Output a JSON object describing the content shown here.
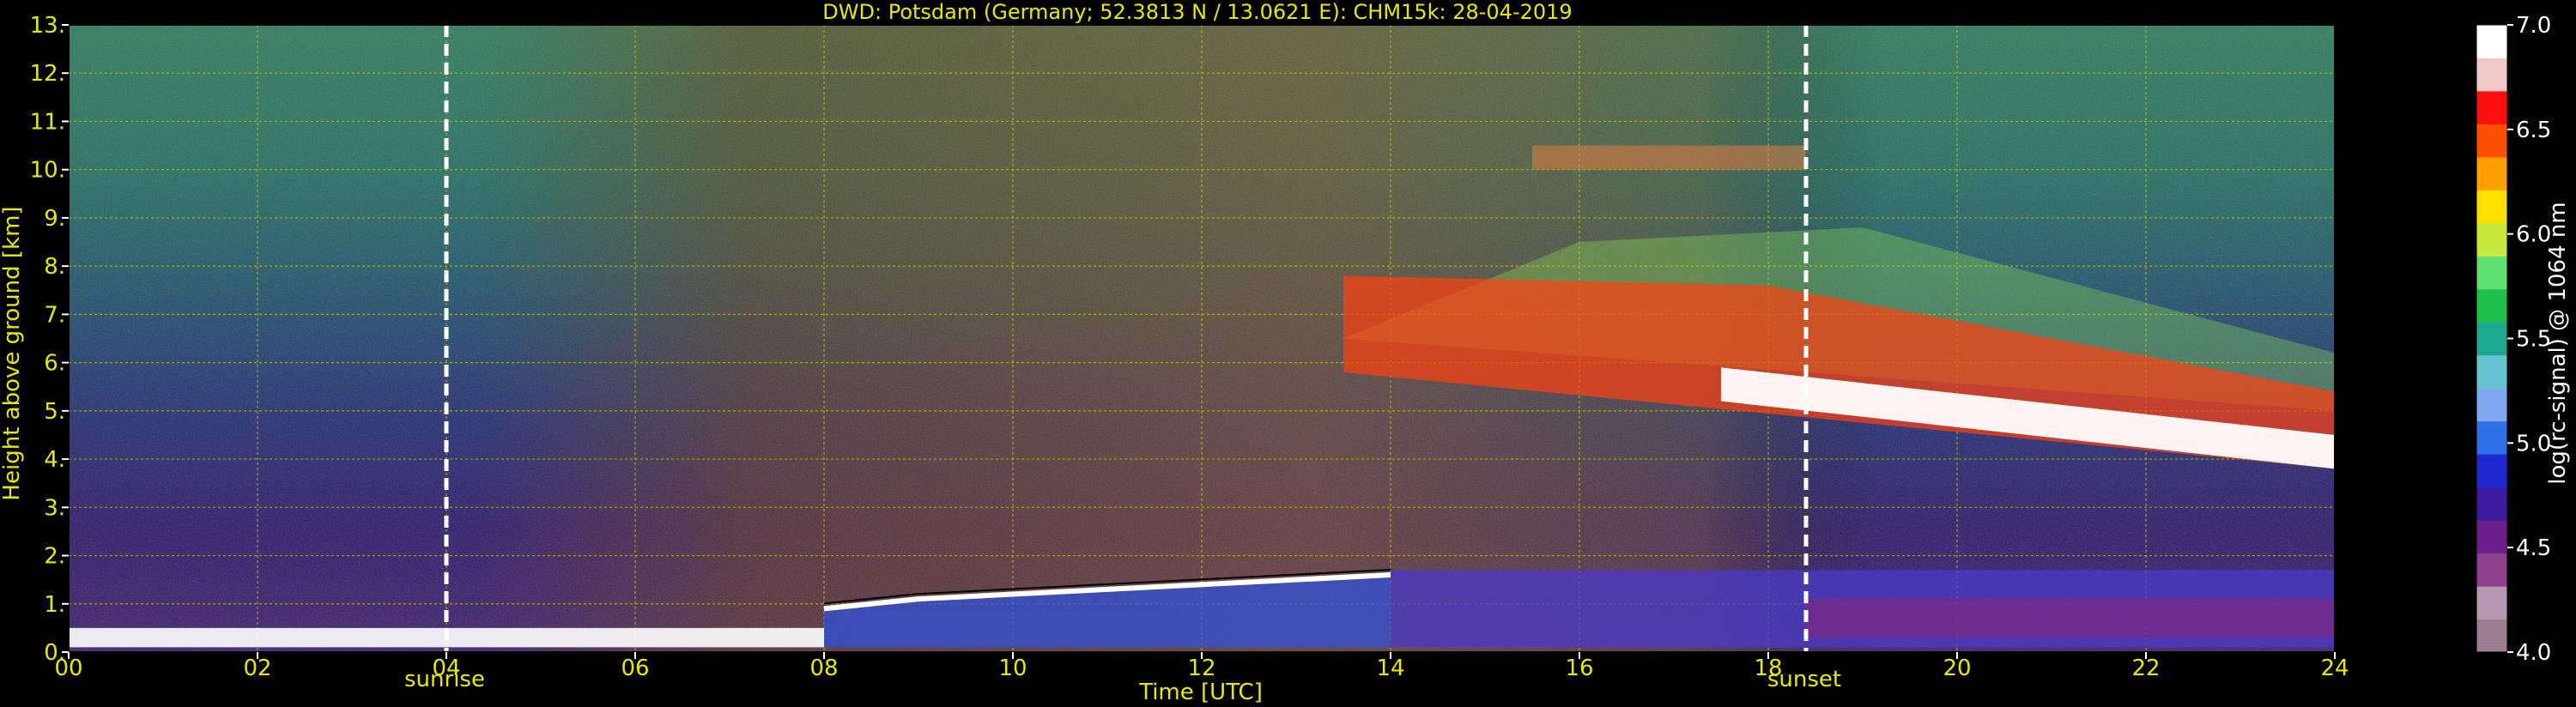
{
  "chart_data": {
    "type": "heatmap",
    "title": "DWD: Potsdam (Germany; 52.3813 N / 13.0621 E):    CHM15k: 28-04-2019",
    "xlabel": "Time [UTC]",
    "ylabel": "Height above ground [km]",
    "xlim": [
      0,
      24
    ],
    "ylim": [
      0,
      13
    ],
    "x_ticks": [
      "00",
      "02",
      "04",
      "06",
      "08",
      "10",
      "12",
      "14",
      "16",
      "18",
      "20",
      "22",
      "24"
    ],
    "y_ticks": [
      "0.",
      "1.",
      "2.",
      "3.",
      "4.",
      "5.",
      "6.",
      "7.",
      "8.",
      "9.",
      "10.",
      "11.",
      "12.",
      "13."
    ],
    "grid": true,
    "annotations": [
      {
        "label": "sunrise",
        "x": 4.0
      },
      {
        "label": "sunset",
        "x": 18.4
      }
    ],
    "colorbar": {
      "label": "log(rc-signal) @ 1064 nm",
      "range": [
        4.0,
        7.0
      ],
      "ticks": [
        "4.0",
        "4.5",
        "5.0",
        "5.5",
        "6.0",
        "6.5",
        "7.0"
      ]
    },
    "layers": [
      {
        "name": "surface-layer",
        "x_start": 0,
        "x_end": 8,
        "height_km": [
          0.1,
          0.5
        ],
        "value": 7.0
      },
      {
        "name": "boundary-layer-top",
        "x": [
          8,
          9,
          10,
          11,
          12,
          13,
          14
        ],
        "height_km": [
          0.9,
          1.1,
          1.2,
          1.3,
          1.4,
          1.5,
          1.6
        ],
        "value": 6.8
      },
      {
        "name": "cirrus-cloud",
        "x_start": 13.5,
        "x_end": 24,
        "top_km": [
          6.5,
          5.0
        ],
        "base_km": [
          5.8,
          3.8
        ],
        "value": 7.0
      }
    ]
  },
  "colors": {
    "text": "#e8e800",
    "grid": "#c8c800",
    "sun_line": "#ffffff",
    "colorbar_stops": [
      "#9c7d91",
      "#b897b0",
      "#8e3f8e",
      "#6a1f8a",
      "#3a1aa0",
      "#2028d0",
      "#2f6fe8",
      "#7fa8f0",
      "#66c4d0",
      "#1fa890",
      "#1fbf50",
      "#5fe070",
      "#c8e840",
      "#ffe000",
      "#ffa000",
      "#ff5000",
      "#ff1010",
      "#f0c8c8",
      "#ffffff"
    ]
  }
}
